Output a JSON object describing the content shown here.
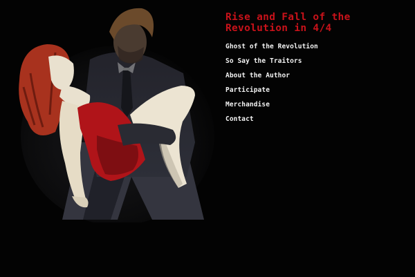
{
  "site": {
    "title_line1": "Rise and Fall of the",
    "title_line2": "Revolution in 4/4",
    "title_color": "#c8121a",
    "background_color": "#030303"
  },
  "nav": {
    "items": [
      {
        "label": "Ghost of the Revolution"
      },
      {
        "label": "So Say the Traitors"
      },
      {
        "label": "About the Author"
      },
      {
        "label": "Participate"
      },
      {
        "label": "Merchandise"
      },
      {
        "label": "Contact"
      }
    ]
  },
  "artwork": {
    "subject": "illustration-man-carrying-woman-in-red-dress",
    "accent_color": "#b01419",
    "hair_color": "#a8321e",
    "skin_color": "#e9e1cf"
  }
}
